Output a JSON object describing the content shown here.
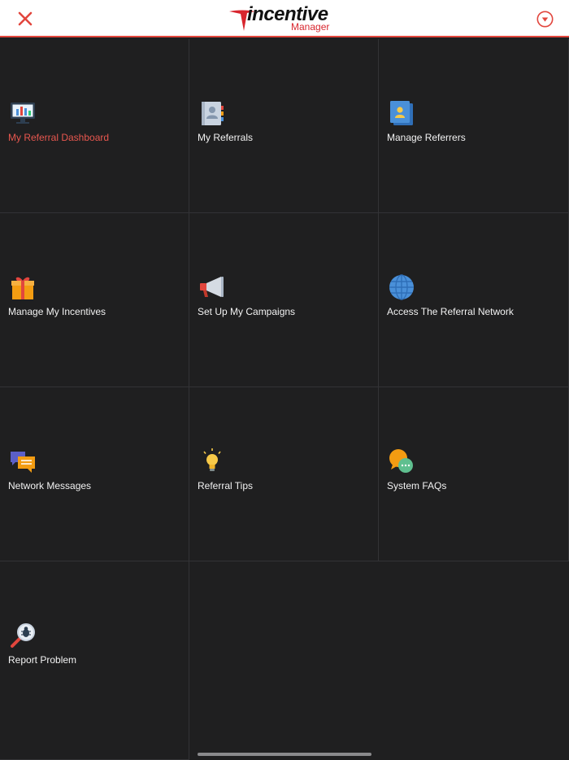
{
  "header": {
    "close_icon": "close-icon",
    "logo_word": "incentive",
    "logo_sub": "Manager",
    "menu_icon": "chevron-down-circle-icon",
    "accent_color": "#e2463d"
  },
  "tiles": [
    {
      "label": "My Referral Dashboard",
      "icon": "dashboard-monitor-icon",
      "active": true
    },
    {
      "label": "My Referrals",
      "icon": "contacts-book-icon"
    },
    {
      "label": "Manage Referrers",
      "icon": "referrers-profile-icon"
    },
    {
      "label": "Manage My Incentives",
      "icon": "gift-icon"
    },
    {
      "label": "Set Up My Campaigns",
      "icon": "megaphone-icon"
    },
    {
      "label": "Access The Referral Network",
      "icon": "globe-icon"
    },
    {
      "label": "Network Messages",
      "icon": "chat-bubbles-icon"
    },
    {
      "label": "Referral Tips",
      "icon": "lightbulb-icon"
    },
    {
      "label": "System FAQs",
      "icon": "faq-bubbles-icon"
    },
    {
      "label": "Report Problem",
      "icon": "bug-search-icon"
    }
  ]
}
